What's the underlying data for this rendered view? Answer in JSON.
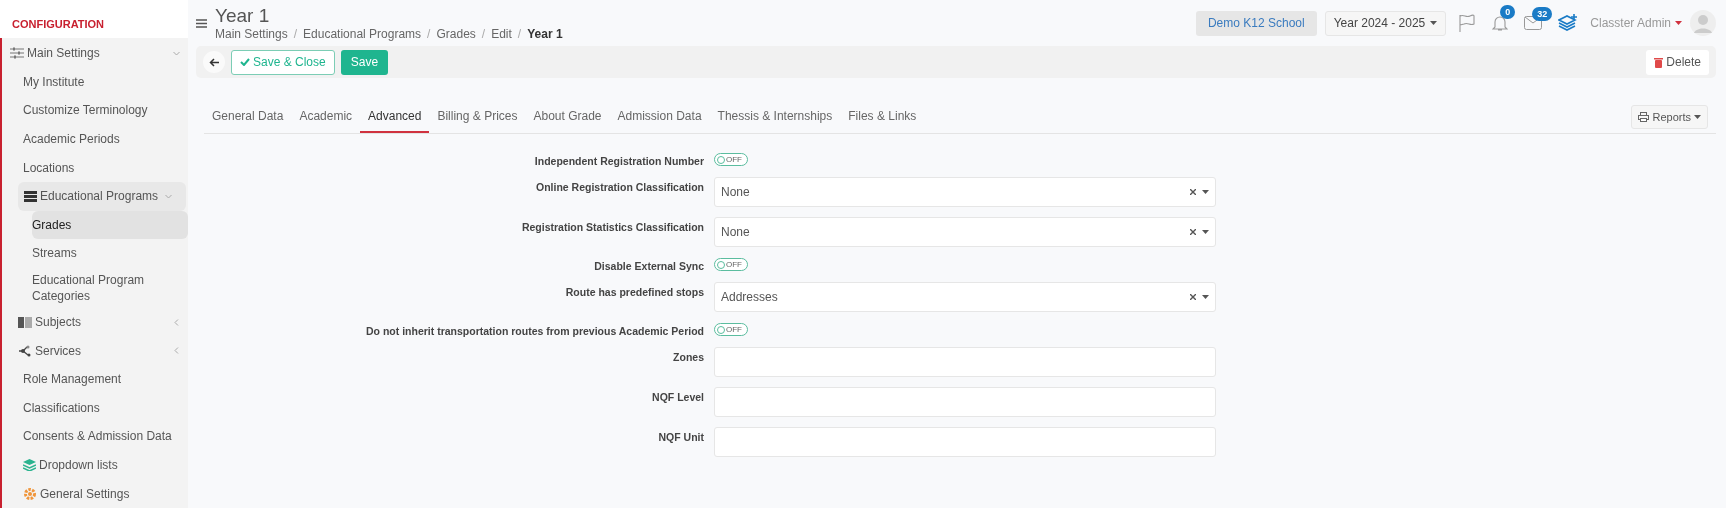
{
  "sidebar": {
    "heading": "CONFIGURATION",
    "items": [
      {
        "label": "Main Settings",
        "expanded": true,
        "selected": false,
        "children": [
          {
            "label": "My Institute",
            "selected": false
          },
          {
            "label": "Customize Terminology",
            "selected": false
          },
          {
            "label": "Academic Periods",
            "selected": false
          },
          {
            "label": "Locations",
            "selected": false
          },
          {
            "label": "Educational Programs",
            "expanded": true,
            "selected": false,
            "children": [
              {
                "label": "Grades",
                "selected": true
              },
              {
                "label": "Streams",
                "selected": false
              },
              {
                "label": "Educational Program Categories",
                "selected": false
              }
            ]
          },
          {
            "label": "Subjects",
            "expanded": false,
            "selected": false
          },
          {
            "label": "Services",
            "expanded": false,
            "selected": false
          },
          {
            "label": "Role Management",
            "selected": false
          },
          {
            "label": "Classifications",
            "selected": false
          },
          {
            "label": "Consents & Admission Data",
            "selected": false
          },
          {
            "label": "Dropdown lists",
            "selected": false
          },
          {
            "label": "General Settings",
            "selected": false
          }
        ]
      }
    ]
  },
  "header": {
    "title": "Year 1",
    "breadcrumb_separator": "/",
    "breadcrumb": [
      "Main Settings",
      "Educational Programs",
      "Grades",
      "Edit",
      "Year 1"
    ],
    "school": "Demo K12 School",
    "year": "Year 2024 - 2025",
    "notifications": "0",
    "messages": "32",
    "user": "Classter Admin"
  },
  "toolbar": {
    "save_close": "Save & Close",
    "save": "Save",
    "delete": "Delete"
  },
  "tabs": [
    {
      "label": "General Data",
      "selected": false
    },
    {
      "label": "Academic",
      "selected": false
    },
    {
      "label": "Advanced",
      "selected": true
    },
    {
      "label": "Billing & Prices",
      "selected": false
    },
    {
      "label": "About Grade",
      "selected": false
    },
    {
      "label": "Admission Data",
      "selected": false
    },
    {
      "label": "Thessis & Internships",
      "selected": false
    },
    {
      "label": "Files & Links",
      "selected": false
    }
  ],
  "reports": "Reports",
  "fields": [
    {
      "kind": "toggle",
      "label": "Independent Registration Number",
      "on": false,
      "text": "OFF"
    },
    {
      "kind": "select",
      "label": "Online Registration Classification",
      "value": "None"
    },
    {
      "kind": "select",
      "label": "Registration Statistics Classification",
      "value": "None"
    },
    {
      "kind": "toggle",
      "label": "Disable External Sync",
      "on": false,
      "text": "OFF"
    },
    {
      "kind": "select",
      "label": "Route has predefined stops",
      "value": "Addresses"
    },
    {
      "kind": "toggle",
      "label": "Do not inherit transportation routes from previous Academic Period",
      "on": false,
      "text": "OFF"
    },
    {
      "kind": "input",
      "label": "Zones"
    },
    {
      "kind": "input",
      "label": "NQF Level"
    },
    {
      "kind": "input",
      "label": "NQF Unit"
    }
  ]
}
